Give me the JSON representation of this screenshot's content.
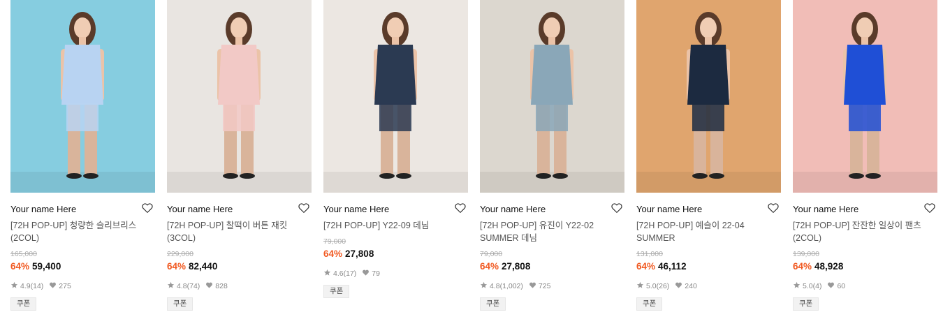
{
  "products": [
    {
      "brand": "Your name Here",
      "name": "[72H POP-UP] 청량한 슬리브리스 (2COL)",
      "original_price": "165,000",
      "discount": "64%",
      "price": "59,400",
      "rating": "4.9",
      "reviews": "(14)",
      "likes": "275",
      "coupon": "쿠폰",
      "background_color": "#86cde0",
      "outfit_color": "#b8d3f2",
      "name_lines": 2
    },
    {
      "brand": "Your name Here",
      "name": "[72H POP-UP] 찰떡이 버튼 재킷 (3COL)",
      "original_price": "229,000",
      "discount": "64%",
      "price": "82,440",
      "rating": "4.8",
      "reviews": "(74)",
      "likes": "828",
      "coupon": "쿠폰",
      "background_color": "#e9e5e1",
      "outfit_color": "#f2c9c6",
      "name_lines": 2
    },
    {
      "brand": "Your name Here",
      "name": "[72H POP-UP] Y22-09 데님",
      "original_price": "79,000",
      "discount": "64%",
      "price": "27,808",
      "rating": "4.6",
      "reviews": "(17)",
      "likes": "79",
      "coupon": "쿠폰",
      "background_color": "#ece7e2",
      "outfit_color": "#2b3a52",
      "name_lines": 1
    },
    {
      "brand": "Your name Here",
      "name": "[72H POP-UP] 유진이 Y22-02 SUMMER 데님",
      "original_price": "79,000",
      "discount": "64%",
      "price": "27,808",
      "rating": "4.8",
      "reviews": "(1,002)",
      "likes": "725",
      "coupon": "쿠폰",
      "background_color": "#dcd7cf",
      "outfit_color": "#8aa7b8",
      "name_lines": 2
    },
    {
      "brand": "Your name Here",
      "name": "[72H POP-UP] 예슬이 22-04 SUMMER",
      "original_price": "131,000",
      "discount": "64%",
      "price": "46,112",
      "rating": "5.0",
      "reviews": "(26)",
      "likes": "240",
      "coupon": "쿠폰",
      "background_color": "#e0a56e",
      "outfit_color": "#1c2a40",
      "name_lines": 2
    },
    {
      "brand": "Your name Here",
      "name": "[72H POP-UP] 잔잔한 일상이 팬츠 (2COL)",
      "original_price": "139,000",
      "discount": "64%",
      "price": "48,928",
      "rating": "5.0",
      "reviews": "(4)",
      "likes": "60",
      "coupon": "쿠폰",
      "background_color": "#f1bdb7",
      "outfit_color": "#1f4fd6",
      "name_lines": 2
    }
  ],
  "colors": {
    "discount": "#f15a22",
    "strikethrough": "#aaaaaa",
    "meta": "#888888"
  }
}
